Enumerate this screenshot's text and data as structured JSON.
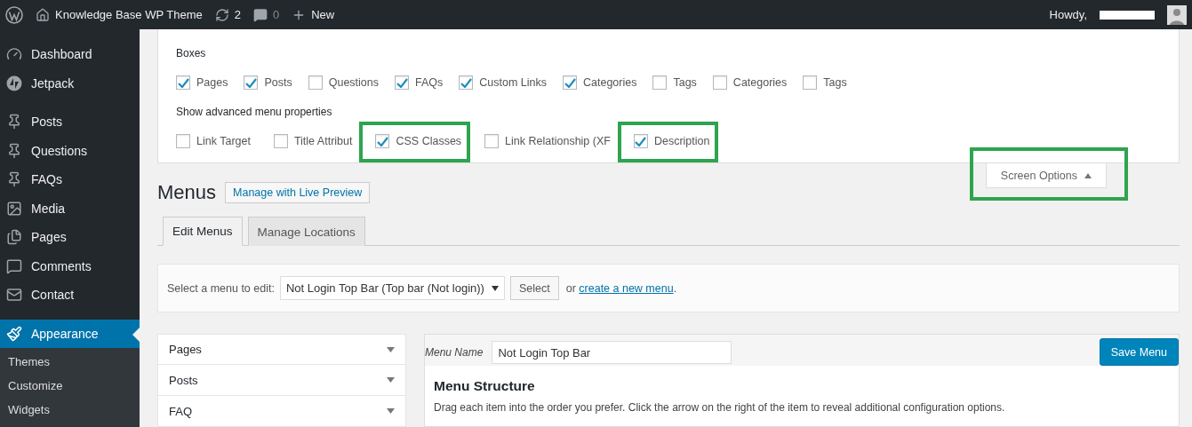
{
  "admin_bar": {
    "site_name": "Knowledge Base WP Theme",
    "updates": "2",
    "comments": "0",
    "new_label": "New",
    "greeting": "Howdy,"
  },
  "sidebar": {
    "items": [
      {
        "label": "Dashboard",
        "selected": false
      },
      {
        "label": "Jetpack",
        "selected": false
      },
      {
        "label": "Posts",
        "selected": false
      },
      {
        "label": "Questions",
        "selected": false
      },
      {
        "label": "FAQs",
        "selected": false
      },
      {
        "label": "Media",
        "selected": false
      },
      {
        "label": "Pages",
        "selected": false
      },
      {
        "label": "Comments",
        "selected": false
      },
      {
        "label": "Contact",
        "selected": false
      },
      {
        "label": "Appearance",
        "selected": true
      }
    ],
    "submenu": [
      "Themes",
      "Customize",
      "Widgets"
    ]
  },
  "screen_options": {
    "boxes_label": "Boxes",
    "boxes": [
      {
        "label": "Pages",
        "checked": true,
        "highlighted": false
      },
      {
        "label": "Posts",
        "checked": true,
        "highlighted": false
      },
      {
        "label": "Questions",
        "checked": false,
        "highlighted": false
      },
      {
        "label": "FAQs",
        "checked": true,
        "highlighted": false
      },
      {
        "label": "Custom Links",
        "checked": true,
        "highlighted": false
      },
      {
        "label": "Categories",
        "checked": true,
        "highlighted": false
      },
      {
        "label": "Tags",
        "checked": false,
        "highlighted": false
      },
      {
        "label": "Categories",
        "checked": false,
        "highlighted": false
      },
      {
        "label": "Tags",
        "checked": false,
        "highlighted": false
      }
    ],
    "advanced_label": "Show advanced menu properties",
    "advanced": [
      {
        "label": "Link Target",
        "checked": false,
        "highlighted": false
      },
      {
        "label": "Title Attribut",
        "checked": false,
        "highlighted": false
      },
      {
        "label": "CSS Classes",
        "checked": true,
        "highlighted": true
      },
      {
        "label": "Link Relationship (XF",
        "checked": false,
        "highlighted": false
      },
      {
        "label": "Description",
        "checked": true,
        "highlighted": true
      }
    ],
    "toggle": {
      "label": "Screen Options",
      "expanded": true,
      "highlighted": true
    }
  },
  "page": {
    "title": "Menus",
    "live_preview": "Manage with Live Preview"
  },
  "tabs": [
    {
      "label": "Edit Menus",
      "selected": true
    },
    {
      "label": "Manage Locations",
      "selected": false
    }
  ],
  "select_bar": {
    "label": "Select a menu to edit:",
    "value": "Not Login Top Bar (Top bar (Not login))",
    "button": "Select",
    "or": "or",
    "link": "create a new menu",
    "suffix": "."
  },
  "accordions": [
    {
      "label": "Pages",
      "expanded": false
    },
    {
      "label": "Posts",
      "expanded": false
    },
    {
      "label": "FAQ",
      "expanded": false
    }
  ],
  "menu_editor": {
    "name_label": "Menu Name",
    "name_value": "Not Login Top Bar",
    "save": "Save Menu",
    "heading": "Menu Structure",
    "instructions": "Drag each item into the order you prefer. Click the arrow on the right of the item to reveal additional configuration options."
  }
}
